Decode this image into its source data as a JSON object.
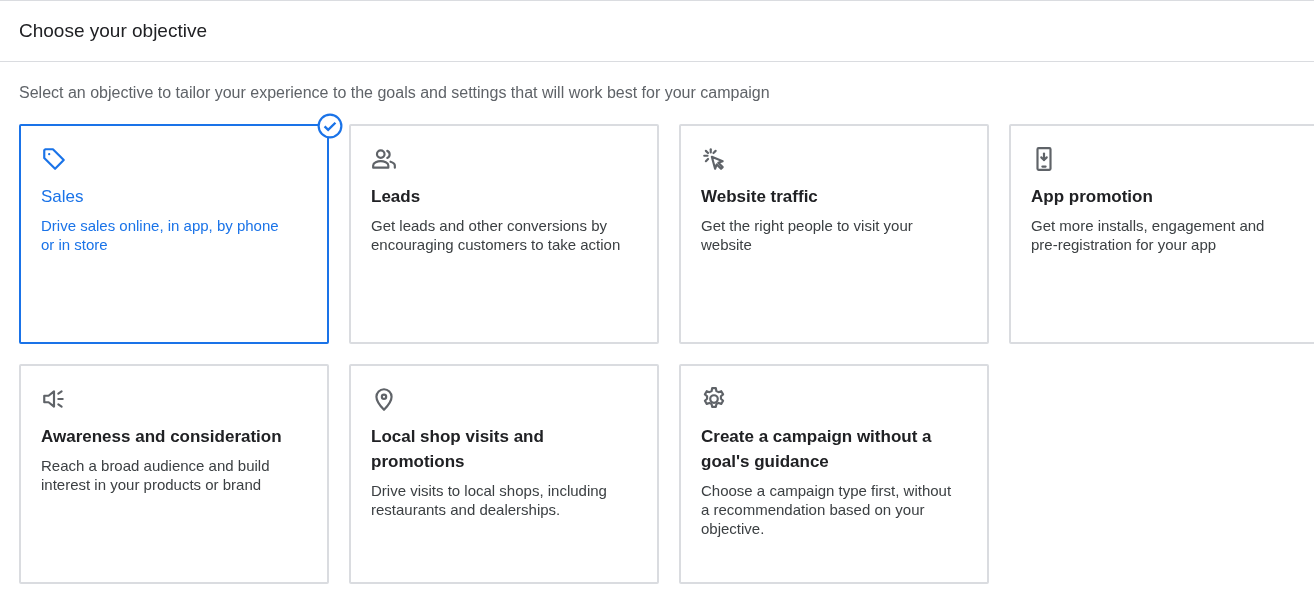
{
  "header": {
    "title": "Choose your objective"
  },
  "intro": "Select an objective to tailor your experience to the goals and settings that will work best for your campaign",
  "objectives": [
    {
      "title": "Sales",
      "description": "Drive sales online, in app, by phone or in store",
      "selected": true
    },
    {
      "title": "Leads",
      "description": "Get leads and other conversions by encouraging customers to take action",
      "selected": false
    },
    {
      "title": "Website traffic",
      "description": "Get the right people to visit your website",
      "selected": false
    },
    {
      "title": "App promotion",
      "description": "Get more installs, engagement and pre-registration for your app",
      "selected": false
    },
    {
      "title": "Awareness and consideration",
      "description": "Reach a broad audience and build interest in your products or brand",
      "selected": false
    },
    {
      "title": "Local shop visits and promotions",
      "description": "Drive visits to local shops, including restaurants and dealerships.",
      "selected": false
    },
    {
      "title": "Create a campaign without a goal's guidance",
      "description": "Choose a campaign type first, without a recommendation based on your objective.",
      "selected": false
    }
  ]
}
